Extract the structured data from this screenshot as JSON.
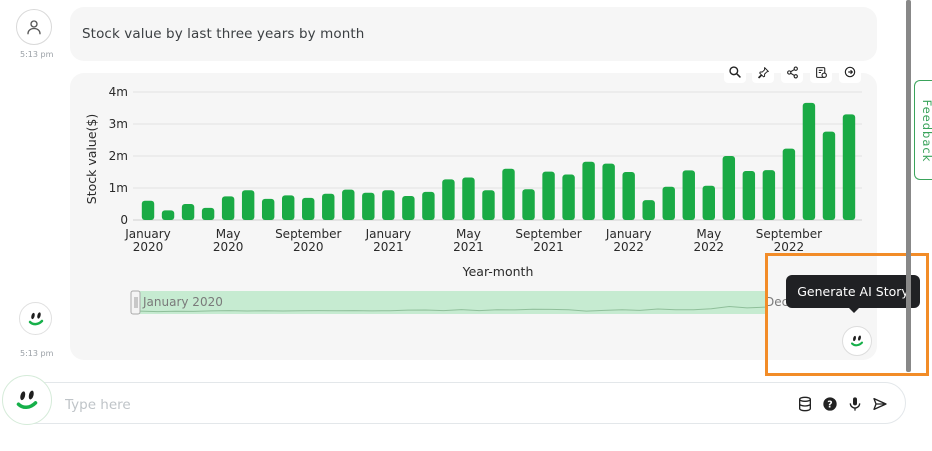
{
  "conversation": {
    "user_message": "Stock value by last three years by month",
    "user_time": "5:13 pm",
    "bot_time": "5:13 pm"
  },
  "chart_toolbar": {
    "icons": [
      "search-icon",
      "pin-icon",
      "share-icon",
      "export-icon",
      "settings-icon"
    ]
  },
  "chart_data": {
    "type": "bar",
    "ylabel": "Stock value($)",
    "xlabel": "Year-month",
    "yticks": [
      "0",
      "1m",
      "2m",
      "3m",
      "4m"
    ],
    "ylim": [
      0,
      4000000
    ],
    "color": "#1aaa45",
    "x_tick_labels": [
      {
        "line1": "January",
        "line2": "2020"
      },
      {
        "line1": "May",
        "line2": "2020"
      },
      {
        "line1": "September",
        "line2": "2020"
      },
      {
        "line1": "January",
        "line2": "2021"
      },
      {
        "line1": "May",
        "line2": "2021"
      },
      {
        "line1": "September",
        "line2": "2021"
      },
      {
        "line1": "January",
        "line2": "2022"
      },
      {
        "line1": "May",
        "line2": "2022"
      },
      {
        "line1": "September",
        "line2": "2022"
      }
    ],
    "x_tick_indices": [
      0,
      4,
      8,
      12,
      16,
      20,
      24,
      28,
      32
    ],
    "categories": [
      "2020-01",
      "2020-02",
      "2020-03",
      "2020-04",
      "2020-05",
      "2020-06",
      "2020-07",
      "2020-08",
      "2020-09",
      "2020-10",
      "2020-11",
      "2020-12",
      "2021-01",
      "2021-02",
      "2021-03",
      "2021-04",
      "2021-05",
      "2021-06",
      "2021-07",
      "2021-08",
      "2021-09",
      "2021-10",
      "2021-11",
      "2021-12",
      "2022-01",
      "2022-02",
      "2022-03",
      "2022-04",
      "2022-05",
      "2022-06",
      "2022-07",
      "2022-08",
      "2022-09",
      "2022-10",
      "2022-11",
      "2022-12"
    ],
    "values": [
      600000,
      300000,
      500000,
      380000,
      740000,
      930000,
      660000,
      770000,
      690000,
      820000,
      950000,
      850000,
      930000,
      750000,
      880000,
      1270000,
      1330000,
      930000,
      1600000,
      960000,
      1510000,
      1420000,
      1820000,
      1760000,
      1500000,
      620000,
      1040000,
      1550000,
      1070000,
      2000000,
      1530000,
      1560000,
      2230000,
      3660000,
      2760000,
      3300000
    ],
    "grid": true,
    "range_slider": {
      "start_label": "January 2020",
      "end_label": "Dec"
    }
  },
  "tooltip": {
    "text": "Generate AI Story"
  },
  "feedback": {
    "label": "Feedback"
  },
  "composer": {
    "placeholder": "Type here",
    "icons": [
      "database-icon",
      "help-icon",
      "microphone-icon",
      "send-icon"
    ]
  }
}
